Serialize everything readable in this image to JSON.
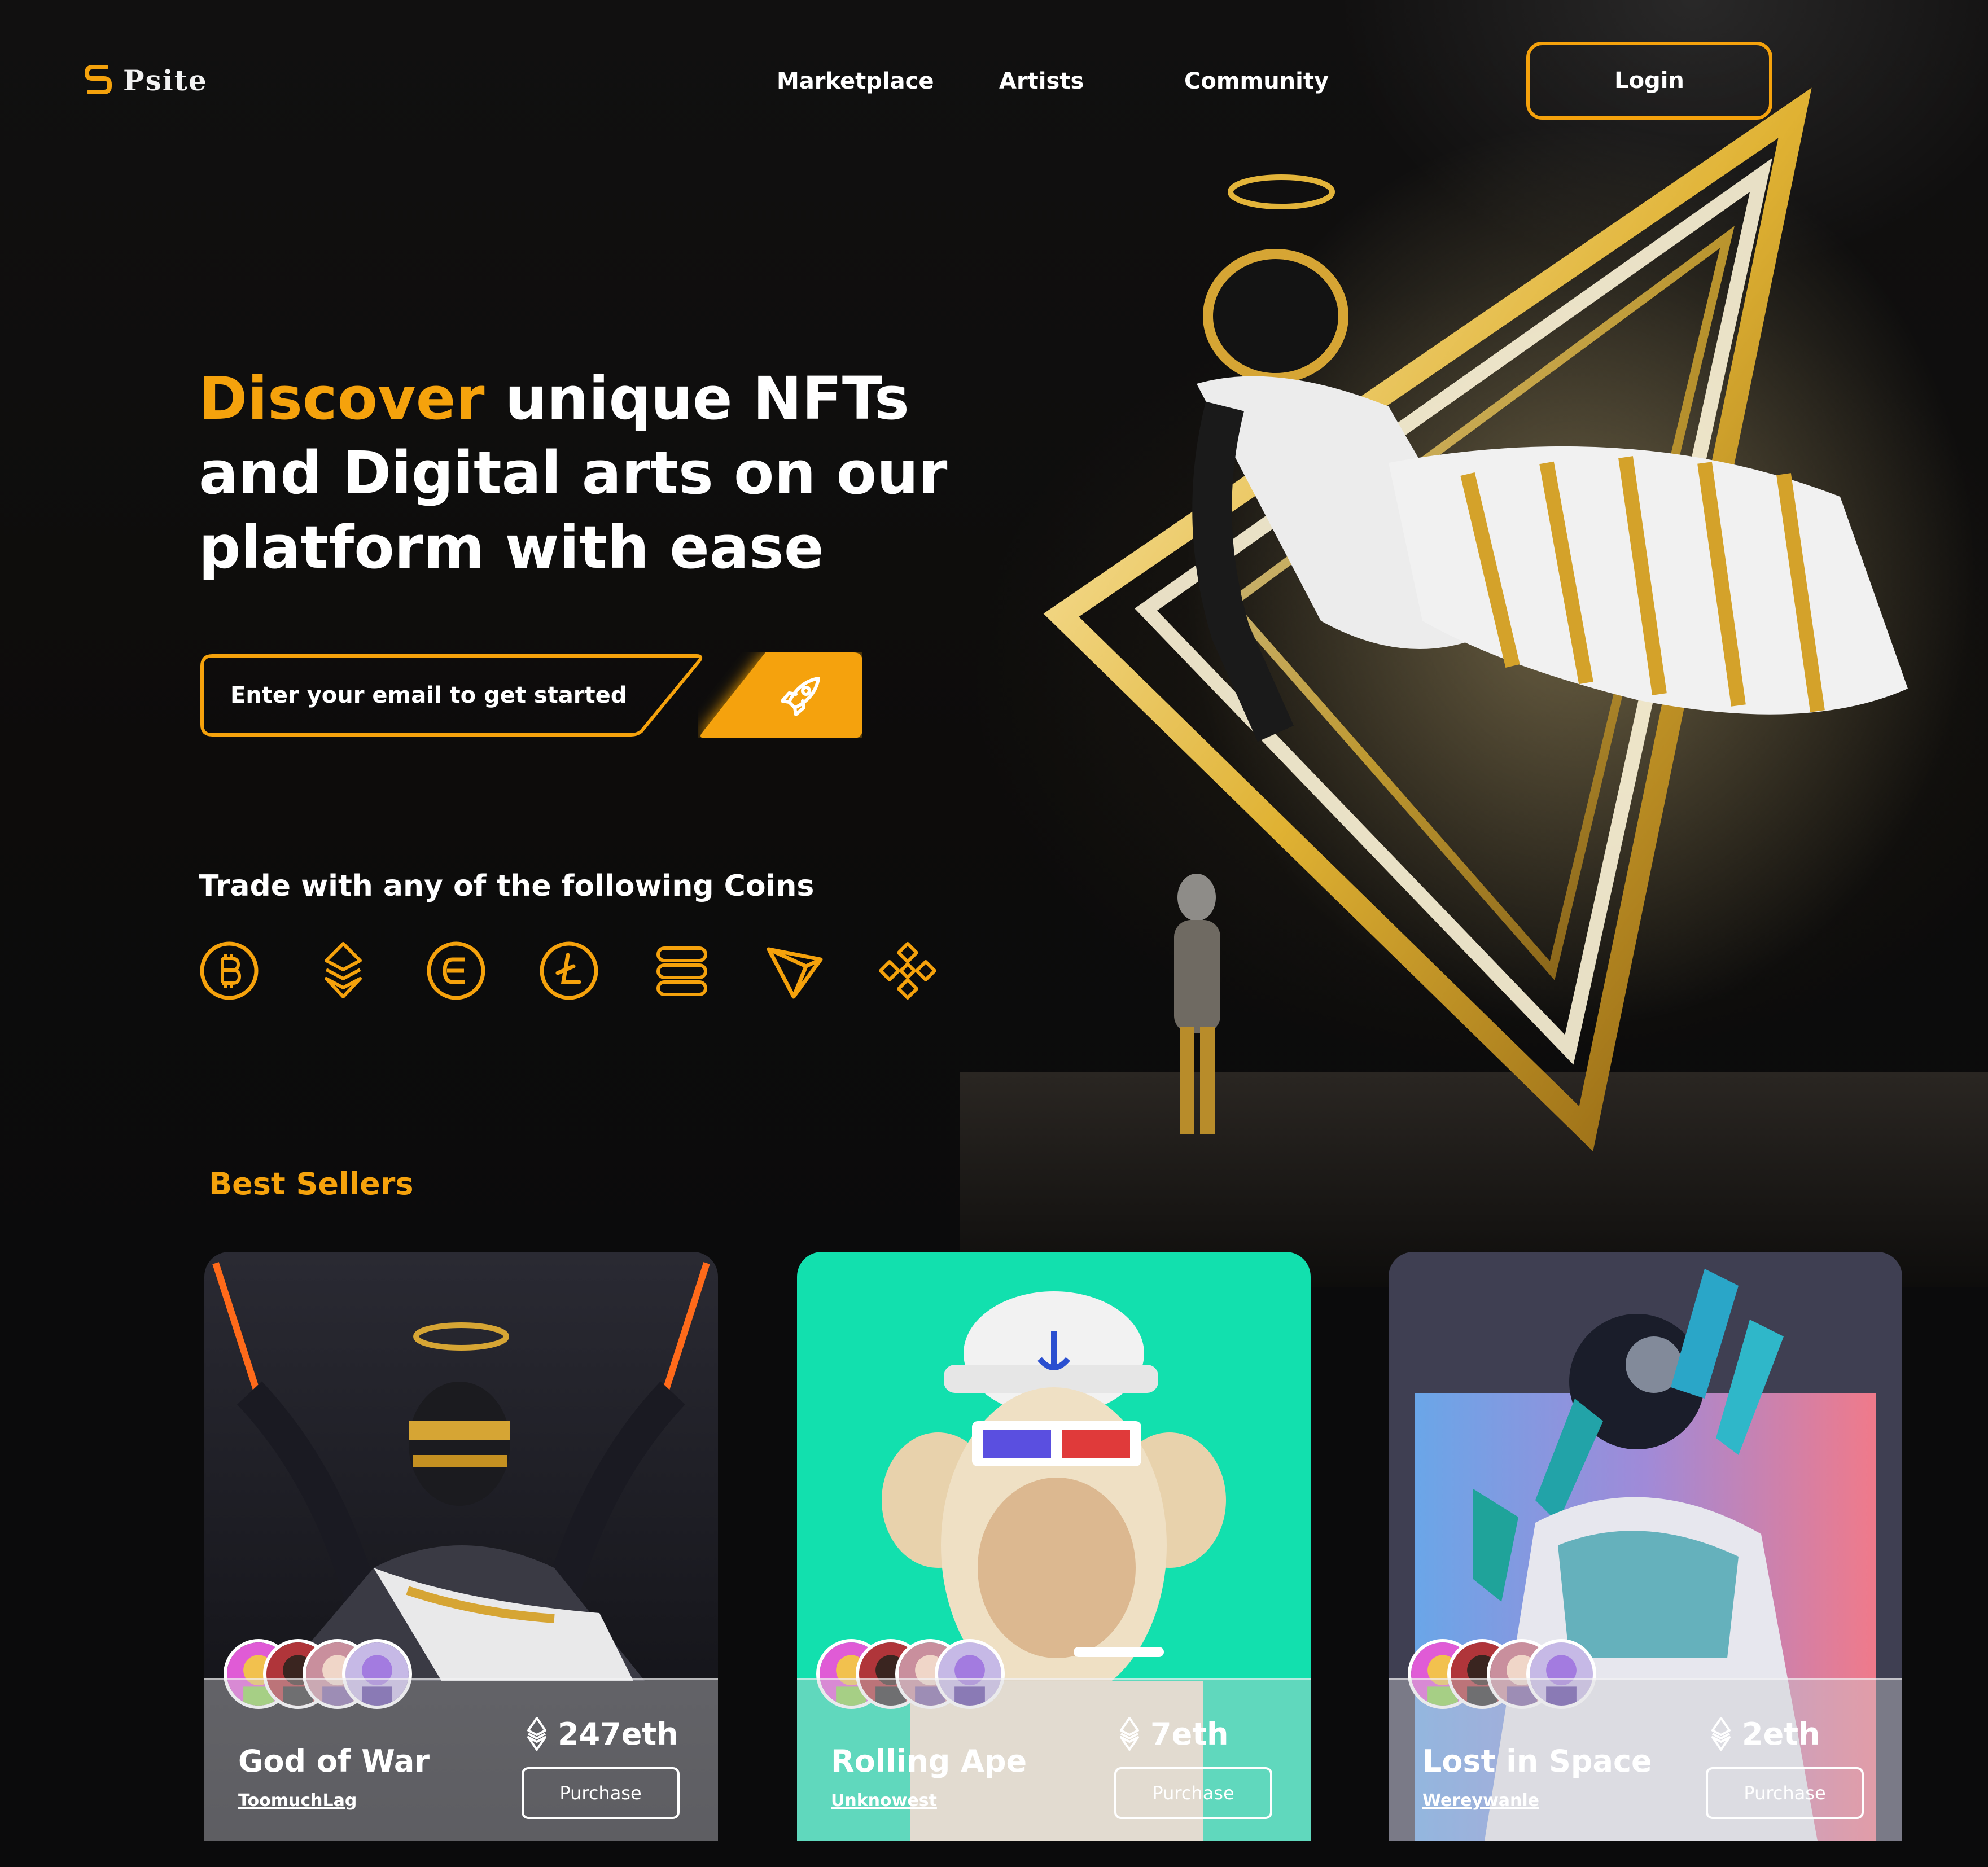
{
  "brand": {
    "name": "Psite",
    "logo_icon": "psite-logo-icon"
  },
  "nav": {
    "items": [
      "Marketplace",
      "Artists",
      "Community"
    ],
    "login_label": "Login"
  },
  "hero": {
    "headline_accent": "Discover",
    "headline_line1_rest": " unique NFTs",
    "headline_line2": "and Digital arts on our",
    "headline_line3": "platform with ease",
    "email_placeholder": "Enter your email to get started",
    "submit_icon": "rocket-icon"
  },
  "coins": {
    "title": "Trade with any of the following Coins",
    "icons": [
      "bitcoin-icon",
      "eth-stack-icon",
      "e-coin-icon",
      "litecoin-icon",
      "stack-coin-icon",
      "tron-icon",
      "binance-icon"
    ]
  },
  "best_sellers": {
    "title": "Best Sellers",
    "cards": [
      {
        "title": "God of War",
        "author": "ToomuchLag",
        "price": "247eth",
        "button": "Purchase",
        "art": "dark-gold-angel-figure"
      },
      {
        "title": "Rolling Ape",
        "author": "Unknowest",
        "price": "7eth",
        "button": "Purchase",
        "art": "sailor-ape-3d-glasses"
      },
      {
        "title": "Lost in Space",
        "author": "Wereywanle",
        "price": "2eth",
        "button": "Purchase",
        "art": "crystal-astronaut"
      }
    ]
  },
  "colors": {
    "accent": "#f5a20c",
    "background": "#0b0b0c",
    "teal_card": "#12e0ae",
    "text": "#ffffff"
  }
}
